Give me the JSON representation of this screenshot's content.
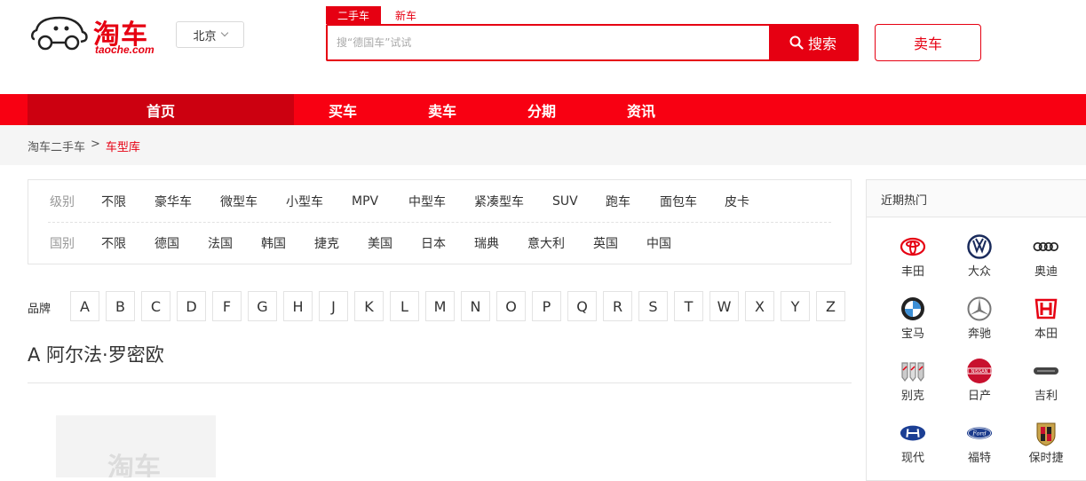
{
  "header": {
    "logo_text": "淘车",
    "logo_sub": "taoche.com",
    "city": "北京",
    "search_tabs": [
      "二手车",
      "新车"
    ],
    "search_placeholder": "搜“德国车”试试",
    "search_button": "搜索",
    "sell_button": "卖车"
  },
  "nav": [
    "首页",
    "买车",
    "卖车",
    "分期",
    "资讯"
  ],
  "breadcrumb": {
    "home": "淘车二手车",
    "sep": ">",
    "current": "车型库"
  },
  "filter": {
    "level_label": "级别",
    "levels": [
      "不限",
      "豪华车",
      "微型车",
      "小型车",
      "MPV",
      "中型车",
      "紧凑型车",
      "SUV",
      "跑车",
      "面包车",
      "皮卡"
    ],
    "country_label": "国别",
    "countries": [
      "不限",
      "德国",
      "法国",
      "韩国",
      "捷克",
      "美国",
      "日本",
      "瑞典",
      "意大利",
      "英国",
      "中国"
    ]
  },
  "brand_letters_label": "品牌",
  "letters": [
    "A",
    "B",
    "C",
    "D",
    "F",
    "G",
    "H",
    "J",
    "K",
    "L",
    "M",
    "N",
    "O",
    "P",
    "Q",
    "R",
    "S",
    "T",
    "W",
    "X",
    "Y",
    "Z"
  ],
  "section_title": "A 阿尔法·罗密欧",
  "placeholder_wm": "淘车",
  "hot": {
    "title": "近期热门",
    "brands": [
      {
        "name": "丰田",
        "icon": "toyota-icon"
      },
      {
        "name": "大众",
        "icon": "volkswagen-icon"
      },
      {
        "name": "奥迪",
        "icon": "audi-icon"
      },
      {
        "name": "宝马",
        "icon": "bmw-icon"
      },
      {
        "name": "奔驰",
        "icon": "mercedes-icon"
      },
      {
        "name": "本田",
        "icon": "honda-icon"
      },
      {
        "name": "别克",
        "icon": "buick-icon"
      },
      {
        "name": "日产",
        "icon": "nissan-icon"
      },
      {
        "name": "吉利",
        "icon": "geely-icon"
      },
      {
        "name": "现代",
        "icon": "hyundai-icon"
      },
      {
        "name": "福特",
        "icon": "ford-icon"
      },
      {
        "name": "保时捷",
        "icon": "porsche-icon"
      }
    ]
  }
}
